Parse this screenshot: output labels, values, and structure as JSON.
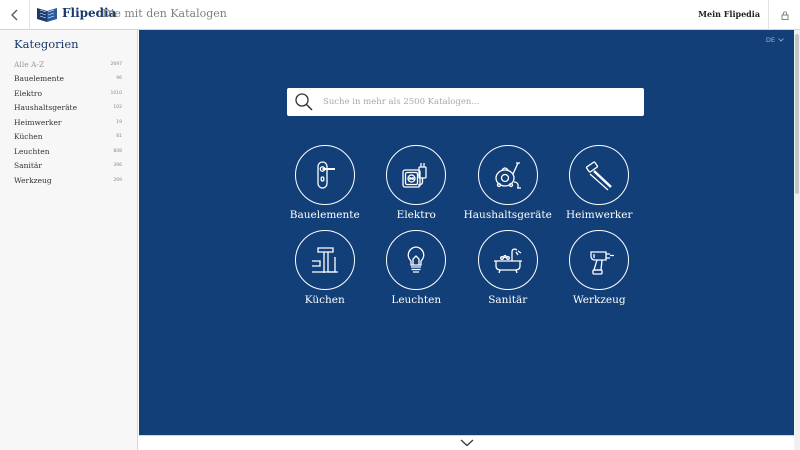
{
  "header": {
    "brand": "Flipedia",
    "tagline": "Die mit den Katalogen",
    "account_link": "Mein Flipedia",
    "icons": [
      "chevron-left-icon",
      "book-logo-icon",
      "lock-icon"
    ]
  },
  "sidebar": {
    "title": "Kategorien",
    "items": [
      {
        "label": "Alle A-Z",
        "count": "2697"
      },
      {
        "label": "Bauelemente",
        "count": "96"
      },
      {
        "label": "Elektro",
        "count": "1010"
      },
      {
        "label": "Haushaltsgeräte",
        "count": "102"
      },
      {
        "label": "Heimwerker",
        "count": "19"
      },
      {
        "label": "Küchen",
        "count": "81"
      },
      {
        "label": "Leuchten",
        "count": "808"
      },
      {
        "label": "Sanitär",
        "count": "396"
      },
      {
        "label": "Werkzeug",
        "count": "269"
      }
    ]
  },
  "main": {
    "language": "DE",
    "search": {
      "placeholder": "Suche in mehr als 2500 Katalogen..."
    },
    "categories": [
      {
        "label": "Bauelemente",
        "icon": "door-handle-icon"
      },
      {
        "label": "Elektro",
        "icon": "power-plug-icon"
      },
      {
        "label": "Haushaltsgeräte",
        "icon": "vacuum-cleaner-icon"
      },
      {
        "label": "Heimwerker",
        "icon": "paint-roller-icon"
      },
      {
        "label": "Küchen",
        "icon": "kitchen-faucet-icon"
      },
      {
        "label": "Leuchten",
        "icon": "light-bulb-icon"
      },
      {
        "label": "Sanitär",
        "icon": "bathtub-icon"
      },
      {
        "label": "Werkzeug",
        "icon": "power-drill-icon"
      }
    ]
  },
  "colors": {
    "main_background": "#133f79",
    "brand_blue": "#17396b",
    "sidebar_background": "#f7f7f7"
  }
}
